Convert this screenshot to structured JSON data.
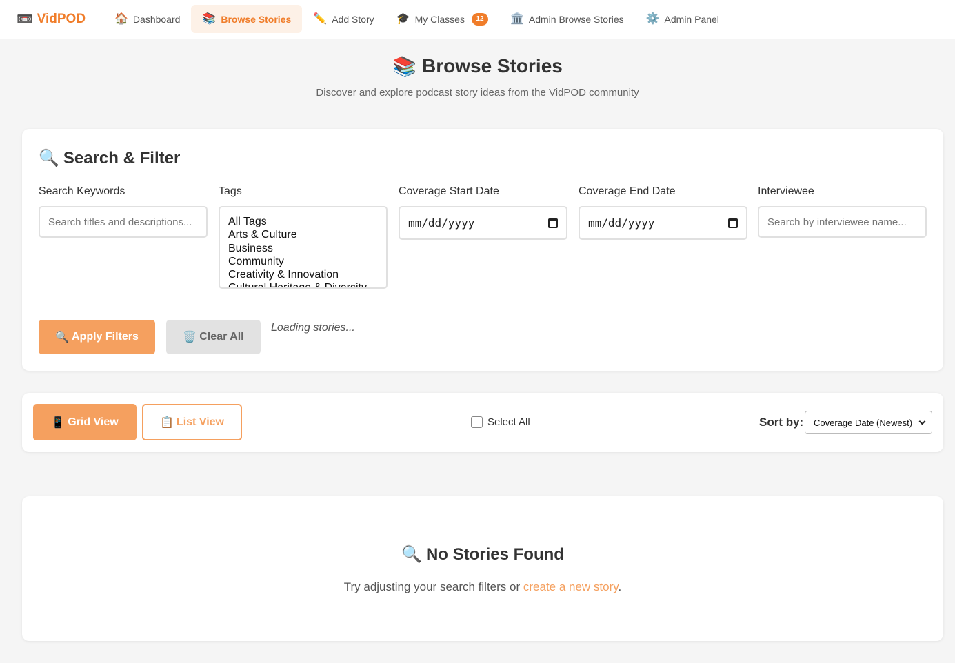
{
  "nav": {
    "brand": {
      "icon": "📼",
      "label": "VidPOD"
    },
    "links": [
      {
        "icon": "🏠",
        "label": "Dashboard"
      },
      {
        "icon": "📚",
        "label": "Browse Stories"
      },
      {
        "icon": "✏️",
        "label": "Add Story"
      },
      {
        "icon": "🎓",
        "label": "My Classes",
        "badge": "12"
      },
      {
        "icon": "🏛️",
        "label": "Admin Browse Stories"
      },
      {
        "icon": "⚙️",
        "label": "Admin Panel"
      }
    ],
    "active_link": "Browse Stories"
  },
  "header": {
    "icon": "📚",
    "title": "Browse Stories",
    "subtitle": "Discover and explore podcast story ideas from the VidPOD community"
  },
  "filters": {
    "icon": "🔍",
    "title": "Search & Filter",
    "keywords": {
      "label": "Search Keywords",
      "placeholder": "Search titles and descriptions..."
    },
    "tags": {
      "label": "Tags",
      "options": [
        "All Tags",
        "Arts & Culture",
        "Business",
        "Community",
        "Creativity & Innovation",
        "Cultural Heritage & Diversity"
      ]
    },
    "start_date": {
      "label": "Coverage Start Date",
      "value": "mm/dd/yyyy"
    },
    "end_date": {
      "label": "Coverage End Date",
      "value": "mm/dd/yyyy"
    },
    "interviewee": {
      "label": "Interviewee",
      "placeholder": "Search by interviewee name..."
    },
    "apply_icon": "🔍",
    "apply_label": "Apply Filters",
    "clear_icon": "🗑️",
    "clear_label": "Clear All",
    "status": "Loading stories..."
  },
  "view": {
    "grid_icon": "📱",
    "grid_label": "Grid View",
    "list_icon": "📋",
    "list_label": "List View",
    "select_all": "Select All",
    "sort_label": "Sort by:",
    "sort_value": "Coverage Date (Newest)"
  },
  "empty": {
    "icon": "🔍",
    "title": "No Stories Found",
    "text_before": "Try adjusting your search filters or ",
    "link": "create a new story",
    "text_after": "."
  },
  "colors": {
    "accent": "#f07d2a",
    "button_accent": "#f5a05f",
    "background": "#f5f5f5"
  }
}
